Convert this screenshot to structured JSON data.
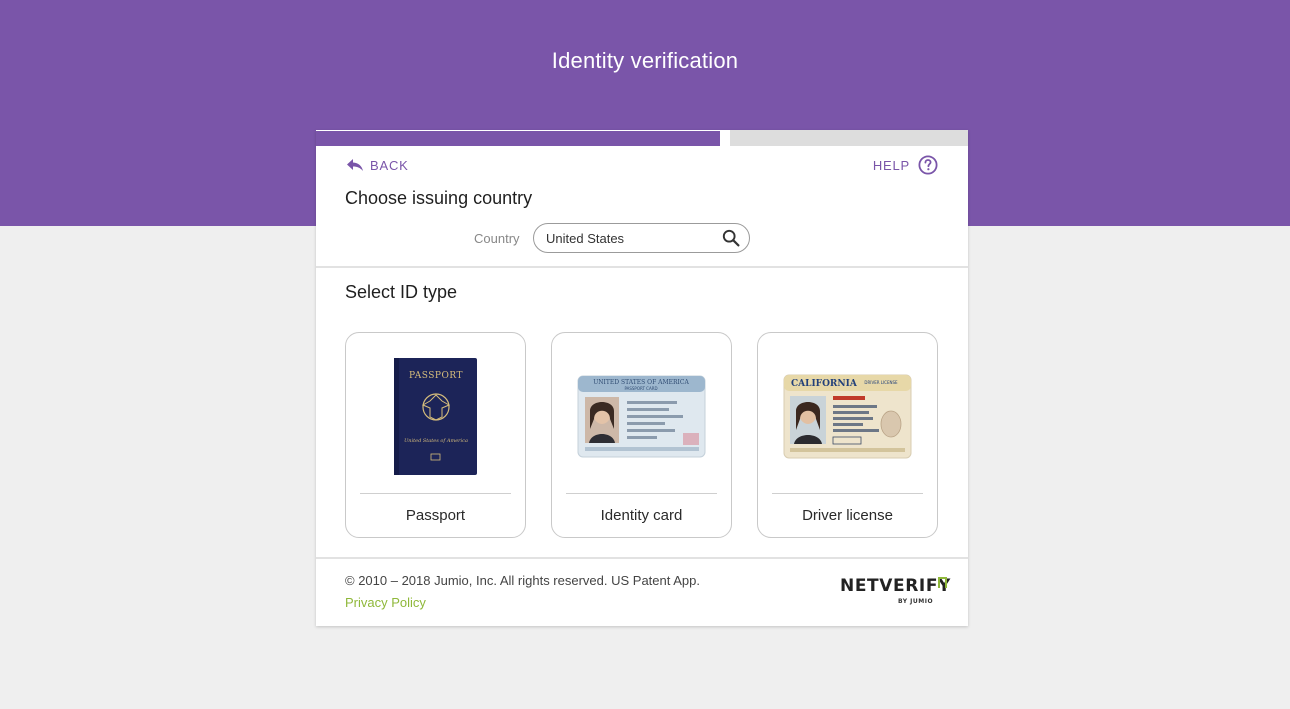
{
  "colors": {
    "brand_purple": "#7a55a9",
    "progress_track": "#dddddd",
    "link_green": "#8fb83a"
  },
  "header": {
    "title": "Identity verification"
  },
  "progress": {
    "completed_fraction": 0.62
  },
  "nav": {
    "back_label": "BACK",
    "back_icon": "back-arrow-icon",
    "help_label": "HELP",
    "help_icon": "help-circle-icon"
  },
  "country_section": {
    "title": "Choose issuing country",
    "field_label": "Country",
    "field_value": "United States",
    "search_icon": "search-icon"
  },
  "id_section": {
    "title": "Select ID type",
    "options": [
      {
        "label": "Passport",
        "image": "passport-image",
        "cover_text": "PASSPORT",
        "cover_subtext": "United States of America"
      },
      {
        "label": "Identity card",
        "image": "identity-card-image",
        "card_header": "UNITED STATES OF AMERICA",
        "card_subheader": "PASSPORT CARD"
      },
      {
        "label": "Driver license",
        "image": "driver-license-image",
        "card_header": "CALIFORNIA",
        "card_subheader": "DRIVER LICENSE"
      }
    ]
  },
  "footer": {
    "copyright": "© 2010 – 2018 Jumio, Inc. All rights reserved. US Patent App.",
    "privacy_label": "Privacy Policy",
    "brand_name": "NETVERIFY",
    "brand_sub": "BY JUMIO"
  }
}
